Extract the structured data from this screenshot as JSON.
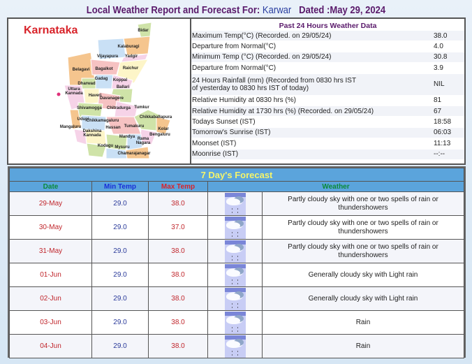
{
  "header": {
    "title_prefix": "Local Weather Report and Forecast For:",
    "city": "Karwar",
    "dated": "Dated :May 29, 2024"
  },
  "map": {
    "state": "Karnataka",
    "districts": [
      "Bidar",
      "Kalaburagi",
      "Vijayapura",
      "Yadgir",
      "Belagavi",
      "Bagalkot",
      "Raichur",
      "Gadag",
      "Koppal",
      "Dharwad",
      "Ballari",
      "Uttara Kannada",
      "Haveri",
      "Davanagere",
      "Shivamogga",
      "Chitradurga",
      "Tumkur",
      "Udupi",
      "Chikkamagaluru",
      "Chikkaballapura",
      "Mangaluru",
      "Hassan",
      "Tumakuru",
      "Kolar",
      "Dakshina Kannada",
      "Mandya",
      "Bengaluru",
      "Rama Nagara",
      "Kodagu",
      "Mysuru",
      "Chamarajanagar"
    ]
  },
  "past24": {
    "title": "Past 24 Hours Weather Data",
    "rows": [
      {
        "label": "Maximum Temp(°C) (Recorded. on 29/05/24)",
        "value": "38.0"
      },
      {
        "label": "Departure from Normal(°C)",
        "value": "4.0"
      },
      {
        "label": "Minimum Temp (°C) (Recorded. on 29/05/24)",
        "value": "30.8"
      },
      {
        "label": "Departure from Normal(°C)",
        "value": "3.9"
      },
      {
        "label": "24 Hours Rainfall (mm) (Recorded from 0830 hrs IST",
        "label2": "of yesterday to 0830 hrs IST of today)",
        "value": "NIL"
      },
      {
        "label": "Relative Humidity at 0830 hrs (%)",
        "value": "81"
      },
      {
        "label": "Relative Humidity at 1730 hrs (%) (Recorded. on 29/05/24)",
        "value": "67"
      },
      {
        "label": "Todays Sunset (IST)",
        "value": "18:58"
      },
      {
        "label": "Tomorrow's Sunrise (IST)",
        "value": "06:03"
      },
      {
        "label": "Moonset (IST)",
        "value": "11:13"
      },
      {
        "label": "Moonrise (IST)",
        "value": "--:--"
      }
    ]
  },
  "forecast": {
    "title": "7 Day's Forecast",
    "columns": {
      "date": "Date",
      "min": "Min Temp",
      "max": "Max Temp",
      "weather": "Weather"
    },
    "colors": {
      "date": "#0a8a3a",
      "min": "#1a2fd8",
      "max": "#d8232a",
      "weather": "#0a8a3a",
      "header_bg": "#5ba4dc"
    },
    "rows": [
      {
        "date": "29-May",
        "min": "29.0",
        "max": "38.0",
        "icon": "rain-cloud-icon",
        "weather": "Partly cloudy sky with one or two spells of rain or thundershowers"
      },
      {
        "date": "30-May",
        "min": "29.0",
        "max": "37.0",
        "icon": "rain-cloud-icon",
        "weather": "Partly cloudy sky with one or two spells of rain or thundershowers"
      },
      {
        "date": "31-May",
        "min": "29.0",
        "max": "38.0",
        "icon": "rain-cloud-icon",
        "weather": "Partly cloudy sky with one or two spells of rain or thundershowers"
      },
      {
        "date": "01-Jun",
        "min": "29.0",
        "max": "38.0",
        "icon": "rain-cloud-icon",
        "weather": "Generally cloudy sky with Light rain"
      },
      {
        "date": "02-Jun",
        "min": "29.0",
        "max": "38.0",
        "icon": "rain-cloud-icon",
        "weather": "Generally cloudy sky with Light rain"
      },
      {
        "date": "03-Jun",
        "min": "29.0",
        "max": "38.0",
        "icon": "rain-cloud-icon",
        "weather": "Rain"
      },
      {
        "date": "04-Jun",
        "min": "29.0",
        "max": "38.0",
        "icon": "rain-cloud-icon",
        "weather": "Rain"
      }
    ]
  }
}
